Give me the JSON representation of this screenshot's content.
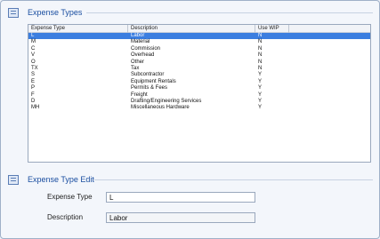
{
  "expense_types": {
    "title": "Expense Types",
    "columns": [
      "Expense Type",
      "Description",
      "Use WIP"
    ],
    "rows": [
      {
        "type": "L",
        "description": "Labor",
        "use_wip": "N",
        "selected": true
      },
      {
        "type": "M",
        "description": "Material",
        "use_wip": "N"
      },
      {
        "type": "C",
        "description": "Commission",
        "use_wip": "N"
      },
      {
        "type": "V",
        "description": "Overhead",
        "use_wip": "N"
      },
      {
        "type": "O",
        "description": "Other",
        "use_wip": "N"
      },
      {
        "type": "TX",
        "description": "Tax",
        "use_wip": "N"
      },
      {
        "type": "S",
        "description": "Subcontractor",
        "use_wip": "Y"
      },
      {
        "type": "E",
        "description": "Equipment Rentals",
        "use_wip": "Y"
      },
      {
        "type": "P",
        "description": "Permits & Fees",
        "use_wip": "Y"
      },
      {
        "type": "F",
        "description": "Freight",
        "use_wip": "Y"
      },
      {
        "type": "D",
        "description": "Drafting/Engineering Services",
        "use_wip": "Y"
      },
      {
        "type": "MH",
        "description": "Miscellaneous Hardware",
        "use_wip": "Y"
      }
    ]
  },
  "expense_type_edit": {
    "title": "Expense Type Edit",
    "expense_type_label": "Expense Type",
    "expense_type_value": "L",
    "description_label": "Description",
    "description_value": "Labor"
  },
  "colors": {
    "accent": "#1a4ea0",
    "selection": "#3b7ee0",
    "background": "#f3f6fb"
  }
}
